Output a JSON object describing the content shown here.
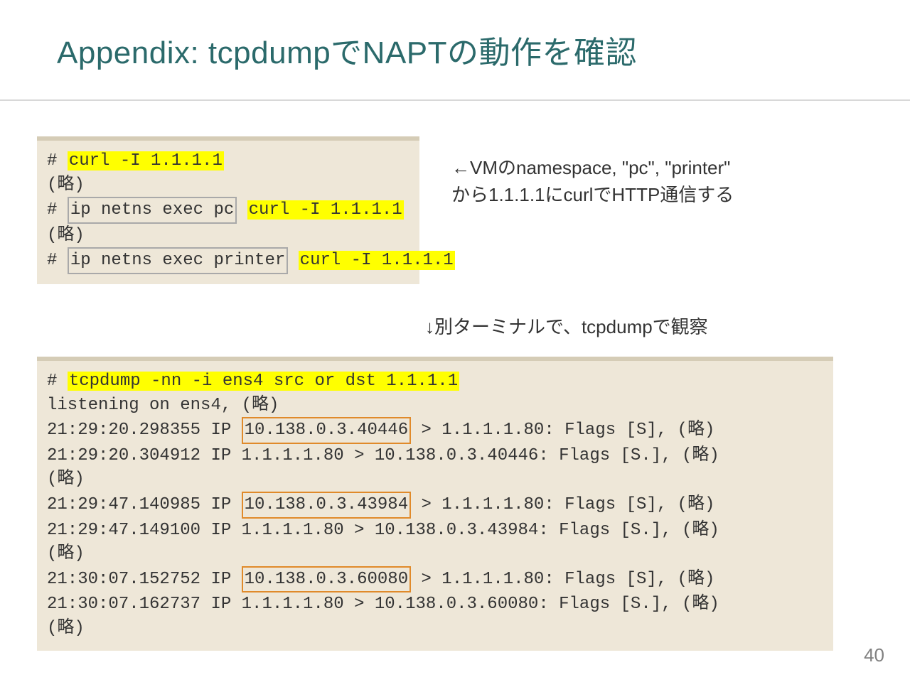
{
  "title": "Appendix: tcpdumpでNAPTの動作を確認",
  "page_number": "40",
  "block_a": {
    "p1_prefix": "# ",
    "p1_hl": "curl -I 1.1.1.1",
    "omit": "(略)",
    "p2_prefix": "# ",
    "p2_box": "ip netns exec pc",
    "p2_sp": " ",
    "p2_hl": "curl -I 1.1.1.1",
    "p3_prefix": "# ",
    "p3_box": "ip netns exec printer",
    "p3_sp": " ",
    "p3_hl": "curl -I 1.1.1.1"
  },
  "annot_a_l1": "←VMのnamespace, \"pc\", \"printer\"",
  "annot_a_l2": "から1.1.1.1にcurlでHTTP通信する",
  "annot_b": "↓別ターミナルで、tcpdumpで観察",
  "block_b": {
    "cmd_prefix": "# ",
    "cmd_hl": "tcpdump -nn -i ens4 src or dst 1.1.1.1",
    "listening": "listening on ens4, (略)",
    "r1a_pre": "21:29:20.298355 IP ",
    "r1a_box": "10.138.0.3.40446",
    "r1a_post": " > 1.1.1.1.80: Flags [S], (略)",
    "r1b": "21:29:20.304912 IP 1.1.1.1.80 > 10.138.0.3.40446: Flags [S.], (略)",
    "omit": "(略)",
    "r2a_pre": "21:29:47.140985 IP ",
    "r2a_box": "10.138.0.3.43984",
    "r2a_post": " > 1.1.1.1.80: Flags [S], (略)",
    "r2b": "21:29:47.149100 IP 1.1.1.1.80 > 10.138.0.3.43984: Flags [S.], (略)",
    "r3a_pre": "21:30:07.152752 IP ",
    "r3a_box": "10.138.0.3.60080",
    "r3a_post": " > 1.1.1.1.80: Flags [S], (略)",
    "r3b": "21:30:07.162737 IP 1.1.1.1.80 > 10.138.0.3.60080: Flags [S.], (略)"
  }
}
